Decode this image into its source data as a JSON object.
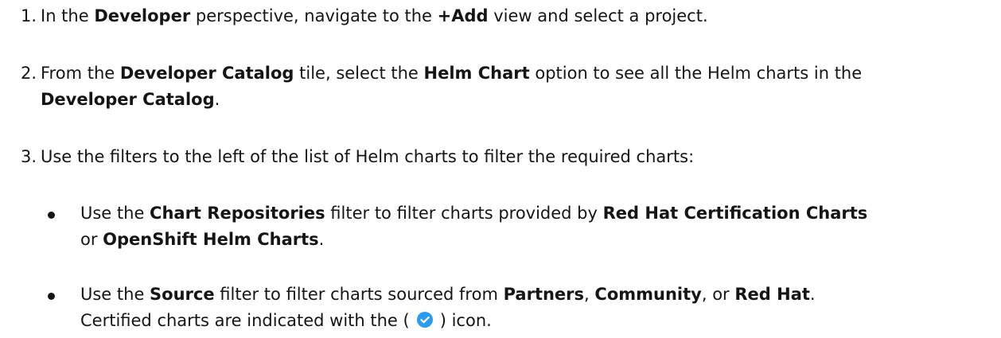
{
  "steps": [
    {
      "number": "1.",
      "text": [
        "In the ",
        "Developer",
        " perspective, navigate to the ",
        "+Add",
        " view and select a project."
      ]
    },
    {
      "number": "2.",
      "text": [
        "From the ",
        "Developer Catalog",
        " tile, select the ",
        "Helm Chart",
        " option to see all the Helm charts in the ",
        "Developer Catalog",
        "."
      ]
    },
    {
      "number": "3.",
      "text": [
        "Use the filters to the left of the list of Helm charts to filter the required charts:"
      ]
    }
  ],
  "substeps": [
    {
      "text": [
        "Use the ",
        "Chart Repositories",
        " filter to filter charts provided by ",
        "Red Hat Certification Charts",
        " or ",
        "OpenShift Helm Charts",
        "."
      ]
    },
    {
      "text": [
        "Use the ",
        "Source",
        " filter to filter charts sourced from ",
        "Partners",
        ", ",
        "Community",
        ", or ",
        "Red Hat",
        ".",
        "Certified charts are indicated with the (",
        ") icon."
      ]
    }
  ],
  "icons": {
    "certified": "certified-badge-icon",
    "certified_color": "#2b9af3"
  }
}
